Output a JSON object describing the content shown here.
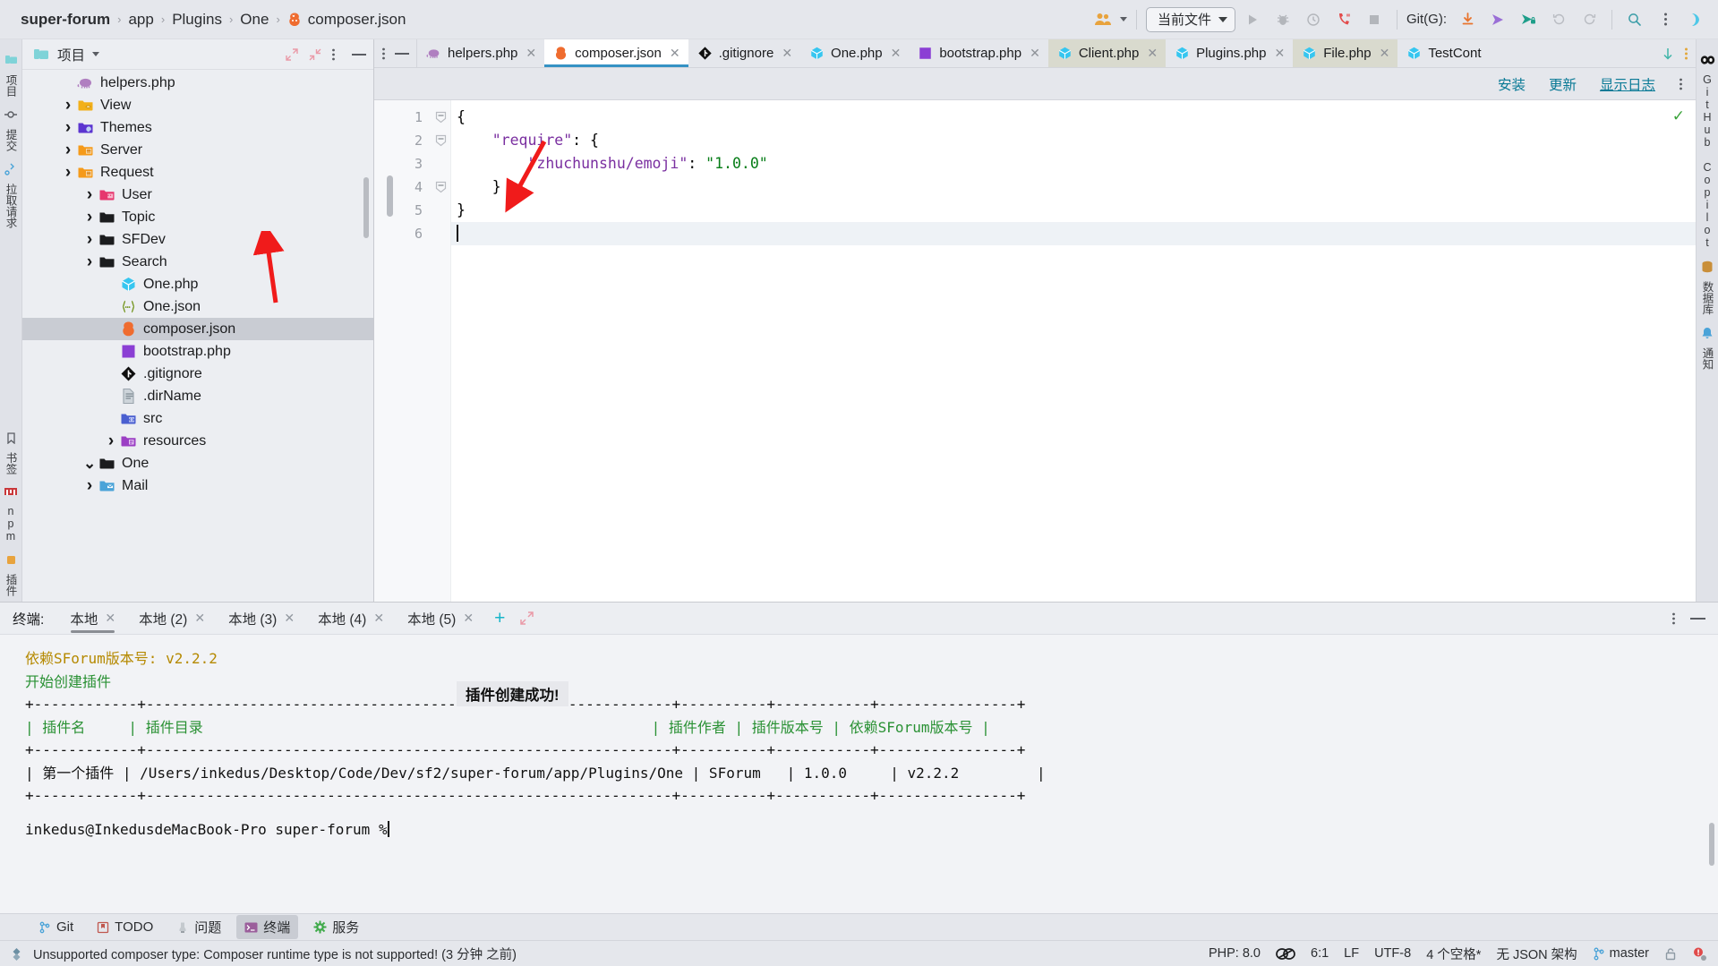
{
  "breadcrumb": {
    "items": [
      {
        "label": "super-forum",
        "bold": true,
        "icon": null
      },
      {
        "label": "app",
        "bold": false,
        "icon": null
      },
      {
        "label": "Plugins",
        "bold": false,
        "icon": null
      },
      {
        "label": "One",
        "bold": false,
        "icon": null
      },
      {
        "label": "composer.json",
        "bold": false,
        "icon": "composer-icon"
      }
    ]
  },
  "toolbar": {
    "run_config": "当前文件",
    "git_label": "Git(G):",
    "icons": [
      "people-icon",
      "run-icon",
      "debug-icon",
      "coverage-icon",
      "profiler-icon",
      "stop-icon",
      "update-project-icon",
      "push-icon",
      "commit-icon",
      "undo-icon",
      "redo-icon",
      "search-everywhere-icon",
      "more-options-icon",
      "ai-assistant-icon"
    ]
  },
  "left_rail": {
    "items": [
      {
        "label": "项目",
        "icon": "project-icon"
      },
      {
        "label": "提交",
        "icon": "commit-icon"
      },
      {
        "label": "拉取请求",
        "icon": "pull-request-icon"
      }
    ]
  },
  "right_rail": {
    "items": [
      {
        "label": "GitHub Copilot",
        "icon": "copilot-icon"
      },
      {
        "label": "数据库",
        "icon": "database-icon"
      },
      {
        "label": "通知",
        "icon": "notification-icon"
      }
    ]
  },
  "left_rail_bottom": {
    "items": [
      {
        "label": "书签",
        "icon": "bookmark-icon"
      },
      {
        "label": "npm",
        "icon": "npm-icon"
      },
      {
        "label": "插件",
        "icon": "plugin-icon"
      }
    ]
  },
  "project_panel": {
    "title": "项目",
    "tree": [
      {
        "label": "Mail",
        "indent": 2,
        "arrow": "right",
        "icon": "folder-mail",
        "selected": false
      },
      {
        "label": "One",
        "indent": 2,
        "arrow": "down",
        "icon": "folder-black",
        "selected": false
      },
      {
        "label": "resources",
        "indent": 3,
        "arrow": "right",
        "icon": "folder-resources",
        "selected": false
      },
      {
        "label": "src",
        "indent": 3,
        "arrow": "none",
        "icon": "folder-src",
        "selected": false
      },
      {
        "label": ".dirName",
        "indent": 3,
        "arrow": "none",
        "icon": "file-text",
        "selected": false
      },
      {
        "label": ".gitignore",
        "indent": 3,
        "arrow": "none",
        "icon": "git-icon",
        "selected": false
      },
      {
        "label": "bootstrap.php",
        "indent": 3,
        "arrow": "none",
        "icon": "blade-icon",
        "selected": false
      },
      {
        "label": "composer.json",
        "indent": 3,
        "arrow": "none",
        "icon": "composer-icon",
        "selected": true
      },
      {
        "label": "One.json",
        "indent": 3,
        "arrow": "none",
        "icon": "json-icon",
        "selected": false
      },
      {
        "label": "One.php",
        "indent": 3,
        "arrow": "none",
        "icon": "php-class-icon",
        "selected": false
      },
      {
        "label": "Search",
        "indent": 2,
        "arrow": "right",
        "icon": "folder-black",
        "selected": false
      },
      {
        "label": "SFDev",
        "indent": 2,
        "arrow": "right",
        "icon": "folder-black",
        "selected": false
      },
      {
        "label": "Topic",
        "indent": 2,
        "arrow": "right",
        "icon": "folder-black",
        "selected": false
      },
      {
        "label": "User",
        "indent": 2,
        "arrow": "right",
        "icon": "folder-user",
        "selected": false
      },
      {
        "label": "Request",
        "indent": 1,
        "arrow": "right",
        "icon": "folder-server",
        "selected": false
      },
      {
        "label": "Server",
        "indent": 1,
        "arrow": "right",
        "icon": "folder-server",
        "selected": false
      },
      {
        "label": "Themes",
        "indent": 1,
        "arrow": "right",
        "icon": "folder-themes",
        "selected": false
      },
      {
        "label": "View",
        "indent": 1,
        "arrow": "right",
        "icon": "folder-view",
        "selected": false
      },
      {
        "label": "helpers.php",
        "indent": 1,
        "arrow": "none",
        "icon": "php-icon",
        "selected": false
      }
    ]
  },
  "tabs": [
    {
      "label": "helpers.php",
      "icon": "php-icon",
      "active": false,
      "shaded": false,
      "close": true
    },
    {
      "label": "composer.json",
      "icon": "composer-icon",
      "active": true,
      "shaded": false,
      "close": true
    },
    {
      "label": ".gitignore",
      "icon": "git-icon",
      "active": false,
      "shaded": false,
      "close": true
    },
    {
      "label": "One.php",
      "icon": "php-class-icon",
      "active": false,
      "shaded": false,
      "close": true
    },
    {
      "label": "bootstrap.php",
      "icon": "blade-icon",
      "active": false,
      "shaded": false,
      "close": true
    },
    {
      "label": "Client.php",
      "icon": "php-class-icon",
      "active": false,
      "shaded": true,
      "close": true
    },
    {
      "label": "Plugins.php",
      "icon": "php-class-icon",
      "active": false,
      "shaded": false,
      "close": true
    },
    {
      "label": "File.php",
      "icon": "php-class-icon",
      "active": false,
      "shaded": true,
      "close": true
    },
    {
      "label": "TestCont",
      "icon": "php-class-icon",
      "active": false,
      "shaded": false,
      "close": false
    }
  ],
  "notification_bar": {
    "install": "安装",
    "update": "更新",
    "show_log": "显示日志",
    "more": "more-options-icon"
  },
  "editor": {
    "lines": [
      {
        "num": "1",
        "fold": "minus",
        "tokens": [
          {
            "t": "{",
            "c": "punc"
          }
        ]
      },
      {
        "num": "2",
        "fold": "minus",
        "tokens": [
          {
            "t": "    ",
            "c": "punc"
          },
          {
            "t": "\"require\"",
            "c": "key"
          },
          {
            "t": ": {",
            "c": "punc"
          }
        ]
      },
      {
        "num": "3",
        "fold": "none",
        "tokens": [
          {
            "t": "        ",
            "c": "punc"
          },
          {
            "t": "\"zhuchunshu/emoji\"",
            "c": "key"
          },
          {
            "t": ": ",
            "c": "punc"
          },
          {
            "t": "\"1.0.0\"",
            "c": "str"
          }
        ]
      },
      {
        "num": "4",
        "fold": "minus",
        "tokens": [
          {
            "t": "    }",
            "c": "punc"
          }
        ]
      },
      {
        "num": "5",
        "fold": "none",
        "tokens": [
          {
            "t": "}",
            "c": "punc"
          }
        ]
      },
      {
        "num": "6",
        "fold": "none",
        "tokens": [],
        "current": true,
        "caret": true
      }
    ]
  },
  "terminal": {
    "label": "终端:",
    "tabs": [
      {
        "label": "本地",
        "active": true
      },
      {
        "label": "本地 (2)",
        "active": false
      },
      {
        "label": "本地 (3)",
        "active": false
      },
      {
        "label": "本地 (4)",
        "active": false
      },
      {
        "label": "本地 (5)",
        "active": false
      }
    ],
    "new_tab": "+",
    "output": [
      {
        "text": "依赖SForum版本号: v2.2.2",
        "color": "yellow"
      },
      {
        "text": "开始创建插件",
        "color": "green"
      },
      {
        "text": "+------------+-------------------------------------------------------------+----------+-----------+----------------+",
        "color": "black"
      },
      {
        "text": "| 插件名     | 插件目录                                                    | 插件作者 | 插件版本号 | 依赖SForum版本号 |",
        "color": "green"
      },
      {
        "text": "+------------+-------------------------------------------------------------+----------+-----------+----------------+",
        "color": "black"
      },
      {
        "text": "| 第一个插件 | /Users/inkedus/Desktop/Code/Dev/sf2/super-forum/app/Plugins/One | SForum   | 1.0.0     | v2.2.2         |",
        "color": "black"
      },
      {
        "text": "+------------+-------------------------------------------------------------+----------+-----------+----------------+",
        "color": "black"
      }
    ],
    "banner": "插件创建成功!",
    "prompt": "inkedus@InkedusdeMacBook-Pro super-forum %"
  },
  "tool_windows": [
    {
      "label": "Git",
      "icon": "git-branch-icon",
      "active": false
    },
    {
      "label": "TODO",
      "icon": "todo-icon",
      "active": false
    },
    {
      "label": "问题",
      "icon": "problems-icon",
      "active": false
    },
    {
      "label": "终端",
      "icon": "terminal-icon",
      "active": true
    },
    {
      "label": "服务",
      "icon": "services-icon",
      "active": false
    }
  ],
  "status_bar": {
    "message": "Unsupported composer type: Composer runtime type is not supported! (3 分钟 之前)",
    "message_icon": "event-log-icon",
    "right": [
      {
        "label": "PHP: 8.0",
        "name": "php-version"
      },
      {
        "label": "",
        "name": "php-interpreter-icon"
      },
      {
        "label": "6:1",
        "name": "cursor-position"
      },
      {
        "label": "LF",
        "name": "line-separator"
      },
      {
        "label": "UTF-8",
        "name": "file-encoding"
      },
      {
        "label": "4 个空格*",
        "name": "indent-size"
      },
      {
        "label": "无 JSON 架构",
        "name": "json-schema"
      },
      {
        "label": "master",
        "name": "git-branch"
      },
      {
        "label": "",
        "name": "lock-icon"
      },
      {
        "label": "",
        "name": "inspection-icon"
      }
    ]
  },
  "colors": {
    "accent": "#3592c4",
    "link": "#0a7a96",
    "terminal_green": "#2a9134",
    "terminal_yellow": "#b58900",
    "arrow_red": "#f01b1b",
    "selection": "#c9ccd3"
  }
}
